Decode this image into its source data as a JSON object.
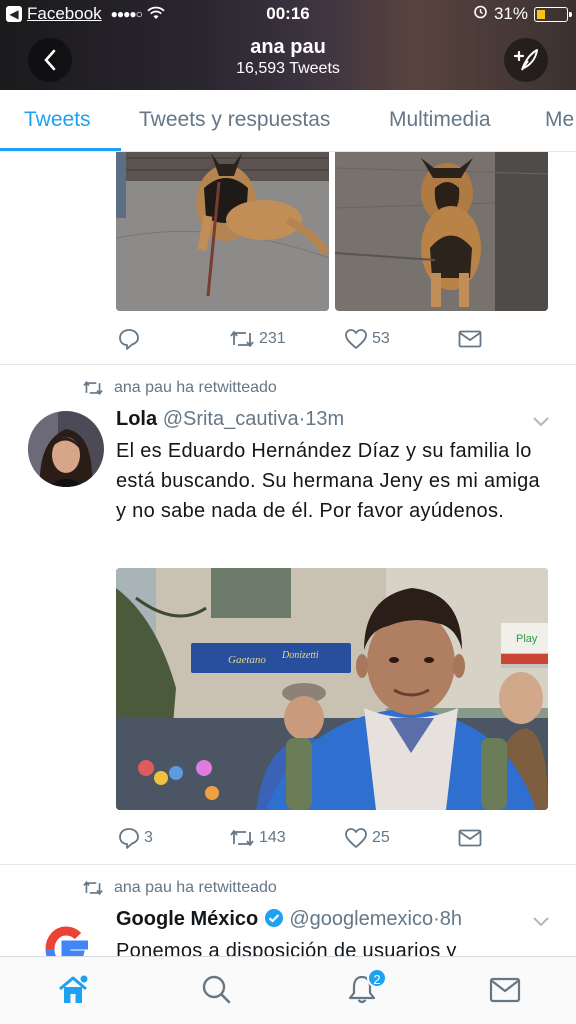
{
  "status_bar": {
    "back_app": "Facebook",
    "time": "00:16",
    "battery_percent": "31%",
    "battery_level": 0.31
  },
  "header": {
    "name": "ana pau",
    "tweet_count": "16,593 Tweets"
  },
  "tabs": [
    {
      "label": "Tweets",
      "active": true
    },
    {
      "label": "Tweets y respuestas",
      "active": false
    },
    {
      "label": "Multimedia",
      "active": false
    },
    {
      "label": "Me",
      "active": false
    }
  ],
  "tweets": [
    {
      "actions": {
        "replies": "",
        "retweets": "231",
        "likes": "53"
      }
    },
    {
      "retweeted_by": "ana pau ha retwitteado",
      "name": "Lola",
      "handle": "@Srita_cautiva",
      "time": "13m",
      "text": "El es Eduardo Hernández Díaz y su familia lo está buscando. Su hermana Jeny es mi amiga y no sabe nada de él. Por favor ayúdenos.",
      "image_signs": [
        "Gaetano",
        "Donizetti",
        "Play"
      ],
      "actions": {
        "replies": "3",
        "retweets": "143",
        "likes": "25"
      }
    },
    {
      "retweeted_by": "ana pau ha retwitteado",
      "name": "Google México",
      "handle": "@googlemexico",
      "time": "8h",
      "text": "Ponemos a disposición de usuarios y"
    }
  ],
  "bottom_nav": {
    "notifications_badge": "2"
  },
  "colors": {
    "accent": "#1da1f2",
    "muted": "#657786",
    "divider": "#e1e8ed"
  }
}
